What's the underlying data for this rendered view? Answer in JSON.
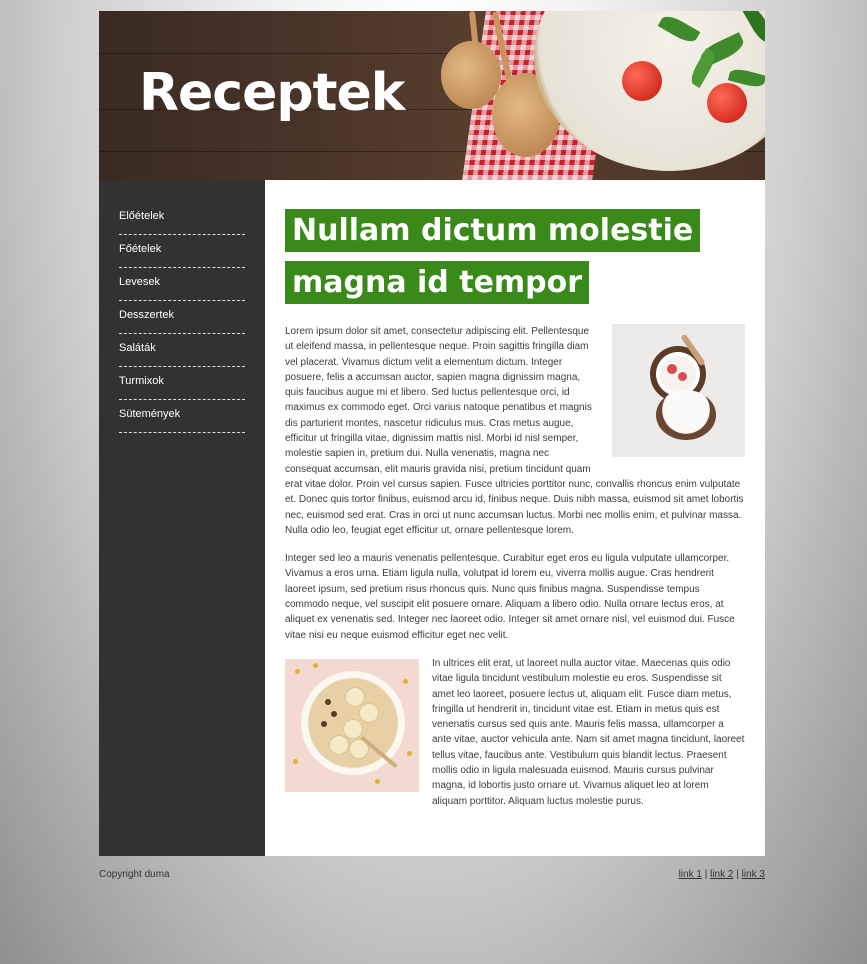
{
  "header": {
    "title": "Receptek"
  },
  "sidebar": {
    "items": [
      {
        "label": "Előételek"
      },
      {
        "label": "Főételek"
      },
      {
        "label": "Levesek"
      },
      {
        "label": "Desszertek"
      },
      {
        "label": "Saláták"
      },
      {
        "label": "Turmixok"
      },
      {
        "label": "Sütemények"
      }
    ]
  },
  "article": {
    "headline": "Nullam dictum molestie magna id tempor",
    "paragraphs": [
      "Lorem ipsum dolor sit amet, consectetur adipiscing elit. Pellentesque ut eleifend massa, in pellentesque neque. Proin sagittis fringilla diam vel placerat. Vivamus dictum velit a elementum dictum. Integer posuere, felis a accumsan auctor, sapien magna dignissim magna, quis faucibus augue mi et libero. Sed luctus pellentesque orci, id maximus ex commodo eget. Orci varius natoque penatibus et magnis dis parturient montes, nascetur ridiculus mus. Cras metus augue, efficitur ut fringilla vitae, dignissim mattis nisl. Morbi id nisl semper, molestie sapien in, pretium dui. Nulla venenatis, magna nec consequat accumsan, elit mauris gravida nisi, pretium tincidunt quam erat vitae dolor. Proin vel cursus sapien. Fusce ultricies porttitor nunc, convallis rhoncus enim vulputate et. Donec quis tortor finibus, euismod arcu id, finibus neque. Duis nibh massa, euismod sit amet lobortis nec, euismod sed erat. Cras in orci ut nunc accumsan luctus. Morbi nec mollis enim, et pulvinar massa. Nulla odio leo, feugiat eget efficitur ut, ornare pellentesque lorem.",
      "Integer sed leo a mauris venenatis pellentesque. Curabitur eget eros eu ligula vulputate ullamcorper. Vivamus a eros urna. Etiam ligula nulla, volutpat id lorem eu, viverra mollis augue. Cras hendrerit laoreet ipsum, sed pretium risus rhoncus quis. Nunc quis finibus magna. Suspendisse tempus commodo neque, vel suscipit elit posuere ornare. Aliquam a libero odio. Nulla ornare lectus eros, at aliquet ex venenatis sed. Integer nec laoreet odio. Integer sit amet ornare nisl, vel euismod dui. Fusce vitae nisi eu neque euismod efficitur eget nec velit.",
      "In ultrices elit erat, ut laoreet nulla auctor vitae. Maecenas quis odio vitae ligula tincidunt vestibulum molestie eu eros. Suspendisse sit amet leo laoreet, posuere lectus ut, aliquam elit. Fusce diam metus, fringilla ut hendrerit in, tincidunt vitae est. Etiam in metus quis est venenatis cursus sed quis ante. Mauris felis massa, ullamcorper a ante vitae, auctor vehicula ante. Nam sit amet magna tincidunt, laoreet tellus vitae, faucibus ante. Vestibulum quis blandit lectus. Praesent mollis odio in ligula malesuada euismod. Mauris cursus pulvinar magna, id lobortis justo ornare ut. Vivamus aliquet leo at lorem aliquam porttitor. Aliquam luctus molestie purus."
    ]
  },
  "footer": {
    "copyright": "Copyright duma",
    "links": [
      "link 1",
      "link 2",
      "link 3"
    ],
    "separator": "|"
  }
}
